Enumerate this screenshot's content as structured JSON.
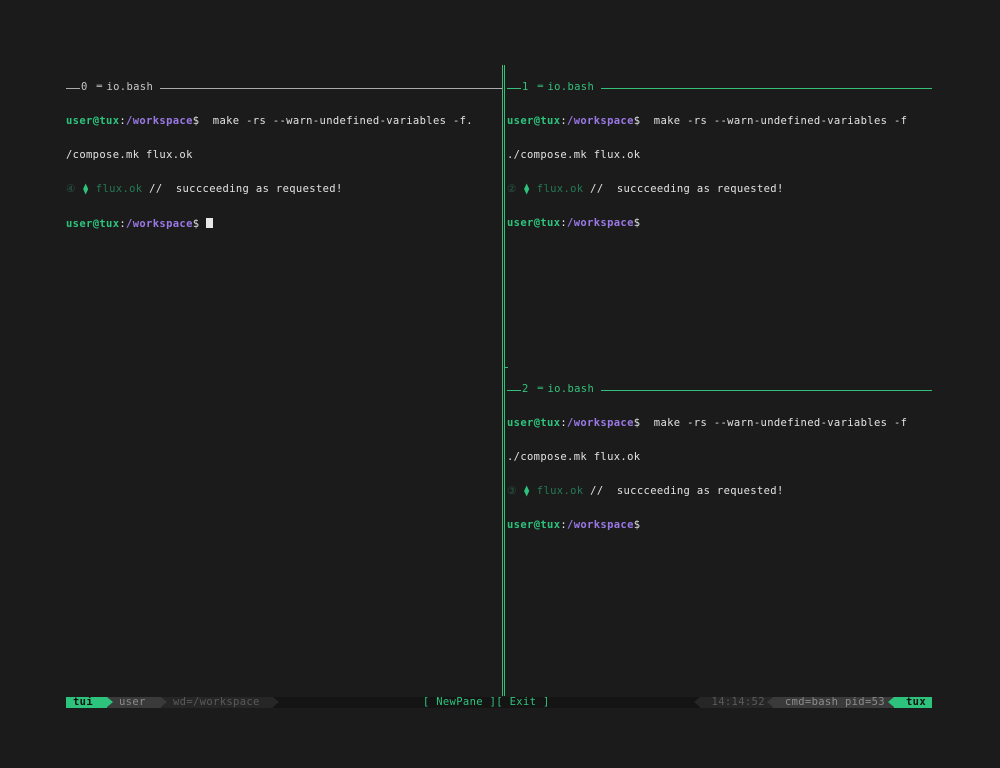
{
  "prompt": {
    "user": "user",
    "at": "@",
    "host": "tux",
    "colon": ":",
    "path": "/workspace",
    "dollar": "$"
  },
  "panes": [
    {
      "index": "0",
      "title": "io.bash",
      "cmd_line1": "  make -rs --warn-undefined-variables -f.",
      "cmd_line2": "/compose.mk flux.ok",
      "out_num": "④",
      "out_target": "flux.ok",
      "out_slash": "//",
      "out_msg": "  succceeding as requested!"
    },
    {
      "index": "1",
      "title": "io.bash",
      "cmd_line1": "  make -rs --warn-undefined-variables -f",
      "cmd_line2": "./compose.mk flux.ok",
      "out_num": "②",
      "out_target": "flux.ok",
      "out_slash": "//",
      "out_msg": "  succceeding as requested!"
    },
    {
      "index": "2",
      "title": "io.bash",
      "cmd_line1": "  make -rs --warn-undefined-variables -f",
      "cmd_line2": "./compose.mk flux.ok",
      "out_num": "③",
      "out_target": "flux.ok",
      "out_slash": "//",
      "out_msg": "  succceeding as requested!"
    }
  ],
  "statusbar": {
    "session": "tui",
    "user": "user",
    "wd": "wd=/workspace",
    "newpane": "[ NewPane ]",
    "exit": "[ Exit ]",
    "time": "14:14:52",
    "proc": "cmd=bash pid=53",
    "host": "tux"
  },
  "colors": {
    "accent": "#2ec37c",
    "path": "#9a78e6",
    "background": "#1b1b1b"
  },
  "icons": {
    "pane_title": "equals-icon",
    "output_marker": "diamond-icon"
  }
}
